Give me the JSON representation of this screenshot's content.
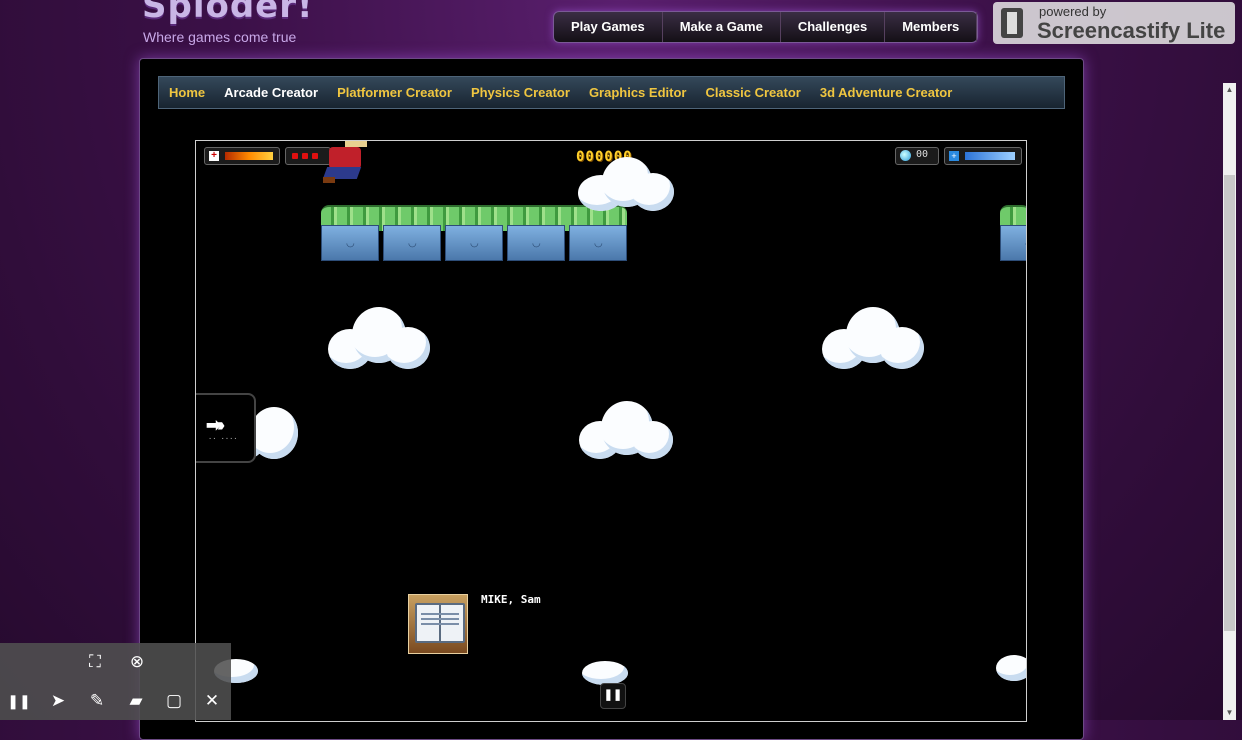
{
  "site": {
    "wordmark": "Sploder!",
    "tagline": "Where games come true"
  },
  "top_nav": {
    "items": [
      "Play Games",
      "Make a Game",
      "Challenges",
      "Members"
    ]
  },
  "screencastify": {
    "powered": "powered by",
    "brand": "Screencastify Lite"
  },
  "sub_nav": {
    "active": "Arcade Creator",
    "items": [
      "Home",
      "Arcade Creator",
      "Platformer Creator",
      "Physics Creator",
      "Graphics Editor",
      "Classic Creator",
      "3d Adventure Creator"
    ]
  },
  "game": {
    "score": "000000",
    "counter": "00",
    "health_fraction": 1.0,
    "mana_fraction": 1.0,
    "lives": 3,
    "caption": "MIKE, Sam",
    "ability_icon": "dash-arrows-icon",
    "pause_icon": "pause-icon"
  },
  "colors": {
    "nav_text": "#f0c640",
    "score": "#ffd02a",
    "background": "#3b1047"
  },
  "toolbar": {
    "icons": [
      "focus-icon",
      "close-circle-icon",
      "pause-icon",
      "cursor-icon",
      "pen-icon",
      "eraser-icon",
      "rectangle-icon",
      "close-icon"
    ]
  }
}
